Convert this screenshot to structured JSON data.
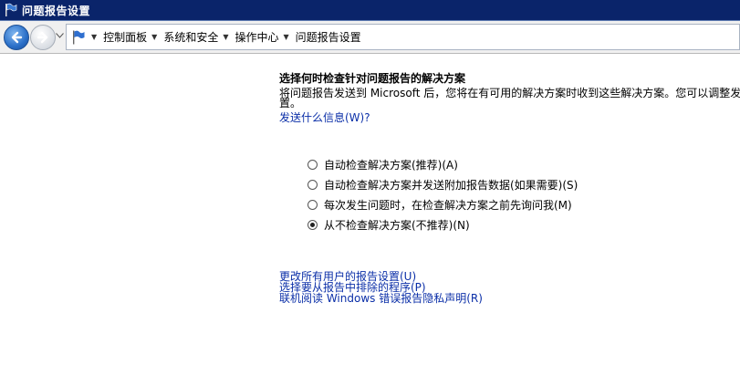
{
  "window": {
    "title": "问题报告设置"
  },
  "breadcrumb": [
    "控制面板",
    "系统和安全",
    "操作中心",
    "问题报告设置"
  ],
  "main": {
    "heading": "选择何时检查针对问题报告的解决方案",
    "description_line1": "将问题报告发送到 Microsoft 后，您将在有可用的解决方案时收到这些解决方案。您可以调整发",
    "description_line2": "置。",
    "what_sent_link": "发送什么信息(W)?",
    "options": [
      {
        "label": "自动检查解决方案(推荐)(A)",
        "checked": false
      },
      {
        "label": "自动检查解决方案并发送附加报告数据(如果需要)(S)",
        "checked": false
      },
      {
        "label": "每次发生问题时，在检查解决方案之前先询问我(M)",
        "checked": false
      },
      {
        "label": "从不检查解决方案(不推荐)(N)",
        "checked": true
      }
    ],
    "links": {
      "change_all_users": "更改所有用户的报告设置(U)",
      "select_programs": "选择要从报告中排除的程序(P)",
      "privacy": "联机阅读 Windows 错误报告隐私声明(R)"
    }
  }
}
